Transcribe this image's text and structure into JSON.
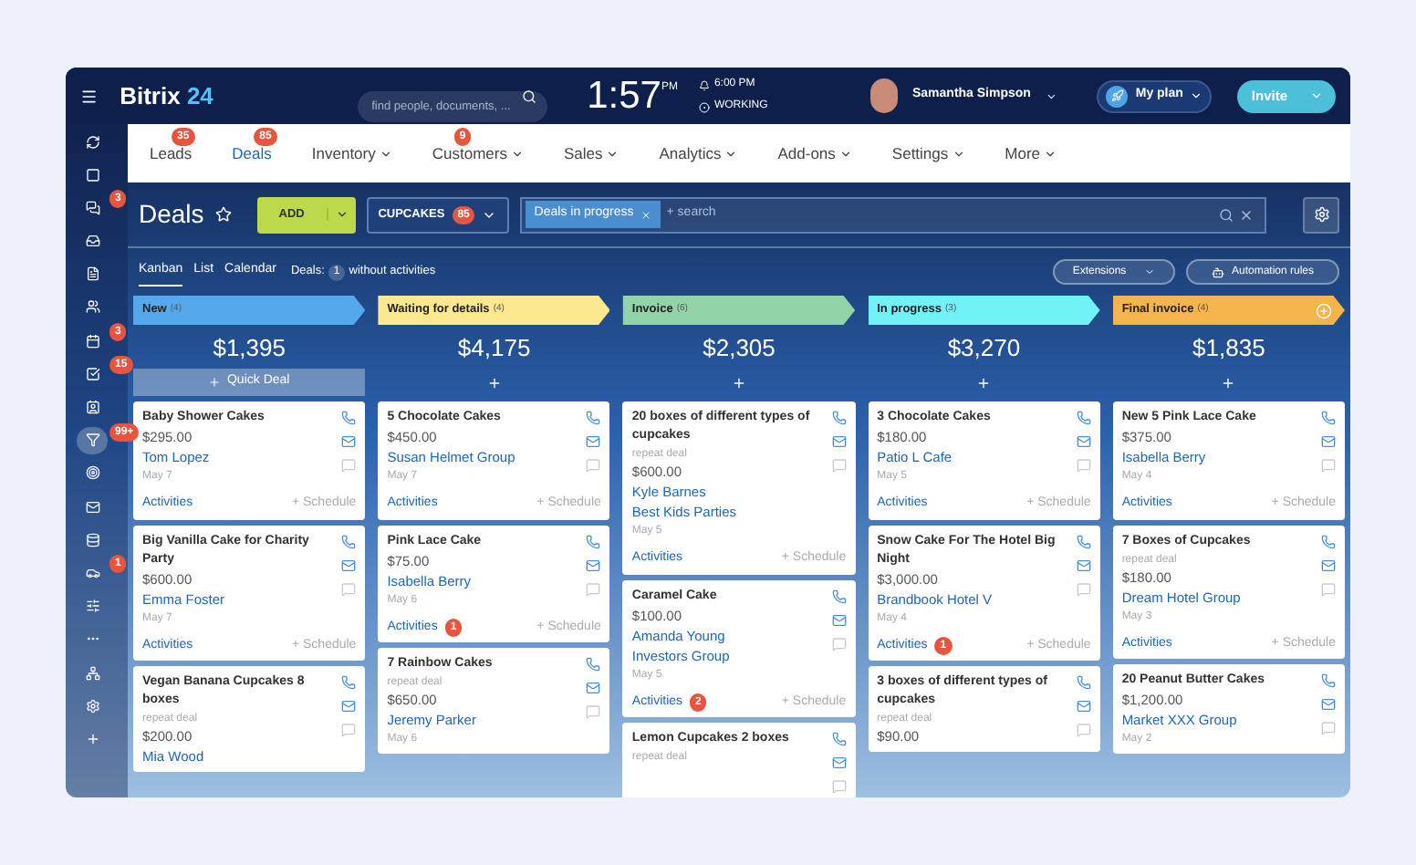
{
  "topbar": {
    "logo": {
      "name": "Bitrix",
      "number": "24"
    },
    "search": {
      "placeholder": "find people, documents, ..."
    },
    "clock": {
      "time": "1:57",
      "meridiem": "PM"
    },
    "alarm": "6:00 PM",
    "status": "WORKING",
    "user": "Samantha Simpson",
    "plan_button": "My plan",
    "invite_button": "Invite"
  },
  "sidebar": {
    "items": [
      {
        "selected": false
      },
      {
        "selected": false
      },
      {
        "selected": false,
        "badge": "3"
      },
      {
        "selected": false
      },
      {
        "selected": false
      },
      {
        "selected": false
      },
      {
        "selected": false,
        "badge": "3"
      },
      {
        "selected": false,
        "badge": "15"
      },
      {
        "selected": false
      },
      {
        "selected": true,
        "badge": "99+"
      },
      {
        "selected": false
      },
      {
        "selected": false
      },
      {
        "selected": false
      },
      {
        "selected": false,
        "badge": "1"
      },
      {
        "selected": false
      },
      {
        "selected": false
      },
      {
        "selected": false
      },
      {
        "selected": false
      },
      {
        "selected": false
      }
    ]
  },
  "nav": {
    "items": [
      {
        "label": "Leads",
        "badge": "35",
        "dropdown": false,
        "selected": false
      },
      {
        "label": "Deals",
        "badge": "85",
        "dropdown": false,
        "selected": true
      },
      {
        "label": "Inventory",
        "dropdown": true,
        "selected": false
      },
      {
        "label": "Customers",
        "badge": "9",
        "dropdown": true,
        "selected": false
      },
      {
        "label": "Sales",
        "dropdown": true,
        "selected": false
      },
      {
        "label": "Analytics",
        "dropdown": true,
        "selected": false
      },
      {
        "label": "Add-ons",
        "dropdown": true,
        "selected": false
      },
      {
        "label": "Settings",
        "dropdown": true,
        "selected": false
      },
      {
        "label": "More",
        "dropdown": true,
        "selected": false
      }
    ]
  },
  "toolbar": {
    "title": "Deals",
    "add_button": "ADD",
    "category_button": {
      "label": "CUPCAKES",
      "badge": "85"
    },
    "filter": {
      "chip": "Deals in progress",
      "placeholder": "+ search"
    }
  },
  "views": [
    {
      "label": "Kanban",
      "selected": true
    },
    {
      "label": "List",
      "selected": false
    },
    {
      "label": "Calendar",
      "selected": false
    }
  ],
  "deals_info": {
    "label": "Deals:",
    "count": "1",
    "text": "without activities"
  },
  "extensions_button": "Extensions",
  "automation_button": "Automation rules",
  "columns": [
    {
      "title": "New",
      "count": "(4)",
      "color": "#55a8ec",
      "total": "$1,395",
      "kind": "quick_deal",
      "action_label": "Quick Deal",
      "header_add": false,
      "cards": [
        {
          "title": "Baby Shower Cakes",
          "amount": "$295.00",
          "contacts": [
            "Tom Lopez"
          ],
          "date": "May 7",
          "activities": "Activities",
          "schedule": "+ Schedule"
        },
        {
          "title": "Big Vanilla Cake for Charity Party",
          "amount": "$600.00",
          "contacts": [
            "Emma Foster"
          ],
          "date": "May 7",
          "activities": "Activities",
          "schedule": "+ Schedule"
        },
        {
          "title": "Vegan Banana Cupcakes 8 boxes",
          "note": "repeat deal",
          "amount": "$200.00",
          "contacts": [
            "Mia Wood"
          ]
        }
      ]
    },
    {
      "title": "Waiting for details",
      "count": "(4)",
      "color": "#fbe88f",
      "total": "$4,175",
      "kind": "add",
      "header_add": false,
      "cards": [
        {
          "title": "5 Chocolate Cakes",
          "amount": "$450.00",
          "contacts": [
            "Susan Helmet Group"
          ],
          "date": "May 7",
          "activities": "Activities",
          "schedule": "+ Schedule"
        },
        {
          "title": "Pink Lace Cake",
          "amount": "$75.00",
          "contacts": [
            "Isabella Berry"
          ],
          "date": "May 6",
          "activities": "Activities",
          "activities_badge": "1",
          "schedule": "+ Schedule"
        },
        {
          "title": "7 Rainbow Cakes",
          "note": "repeat deal",
          "amount": "$650.00",
          "contacts": [
            "Jeremy Parker"
          ],
          "date": "May 6"
        }
      ]
    },
    {
      "title": "Invoice",
      "count": "(6)",
      "color": "#93d3a8",
      "total": "$2,305",
      "kind": "add",
      "header_add": false,
      "cards": [
        {
          "title": "20 boxes of different types of cupcakes",
          "note": "repeat deal",
          "amount": "$600.00",
          "contacts": [
            "Kyle Barnes",
            "Best Kids Parties"
          ],
          "date": "May 5",
          "activities": "Activities",
          "schedule": "+ Schedule"
        },
        {
          "title": "Caramel Cake",
          "amount": "$100.00",
          "contacts": [
            "Amanda Young",
            "Investors Group"
          ],
          "date": "May 5",
          "activities": "Activities",
          "activities_badge": "2",
          "schedule": "+ Schedule"
        },
        {
          "title": "Lemon Cupcakes 2 boxes",
          "note": "repeat deal"
        }
      ]
    },
    {
      "title": "In progress",
      "count": "(3)",
      "color": "#70f2f7",
      "total": "$3,270",
      "kind": "add",
      "header_add": false,
      "cards": [
        {
          "title": "3 Chocolate Cakes",
          "amount": "$180.00",
          "contacts": [
            "Patio L Cafe"
          ],
          "date": "May 5",
          "activities": "Activities",
          "schedule": "+ Schedule"
        },
        {
          "title": "Snow Cake For The Hotel Big Night",
          "amount": "$3,000.00",
          "contacts": [
            "Brandbook Hotel V"
          ],
          "date": "May 4",
          "activities": "Activities",
          "activities_badge": "1",
          "schedule": "+ Schedule"
        },
        {
          "title": "3 boxes of different types of cupcakes",
          "note": "repeat deal",
          "amount": "$90.00"
        }
      ]
    },
    {
      "title": "Final invoice",
      "count": "(4)",
      "color": "#f5b44c",
      "total": "$1,835",
      "kind": "add",
      "header_add": true,
      "cards": [
        {
          "title": "New 5 Pink Lace Cake",
          "amount": "$375.00",
          "contacts": [
            "Isabella Berry"
          ],
          "date": "May 4",
          "activities": "Activities",
          "schedule": "+ Schedule"
        },
        {
          "title": "7 Boxes of Cupcakes",
          "note": "repeat deal",
          "amount": "$180.00",
          "contacts": [
            "Dream Hotel Group"
          ],
          "date": "May 3",
          "activities": "Activities",
          "schedule": "+ Schedule"
        },
        {
          "title": "20 Peanut Butter Cakes",
          "amount": "$1,200.00",
          "contacts": [
            "Market XXX Group"
          ],
          "date": "May 2"
        }
      ]
    }
  ]
}
